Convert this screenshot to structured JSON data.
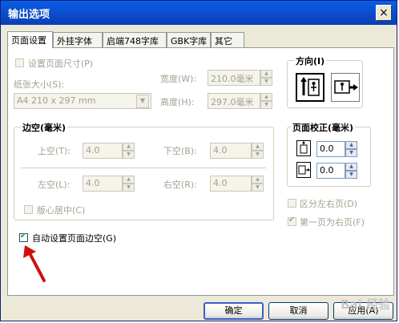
{
  "window": {
    "title": "输出选项",
    "close_label": "×"
  },
  "tabs": [
    {
      "label": "页面设置",
      "active": true
    },
    {
      "label": "外挂字体"
    },
    {
      "label": "启端748字库"
    },
    {
      "label": "GBK字库"
    },
    {
      "label": "其它"
    }
  ],
  "page_setup": {
    "custom_size_label": "设置页面尺寸(P)",
    "paper_size_label": "纸张大小(S):",
    "paper_size_value": "A4 210 x 297 mm",
    "width_label": "宽度(W):",
    "width_value": "210.0毫米",
    "height_label": "高度(H):",
    "height_value": "297.0毫米"
  },
  "orientation": {
    "title": "方向(I)"
  },
  "margins": {
    "title": "边空(毫米)",
    "top_label": "上空(T):",
    "top_value": "4.0",
    "bottom_label": "下空(B):",
    "bottom_value": "4.0",
    "left_label": "左空(L):",
    "left_value": "4.0",
    "right_label": "右空(R):",
    "right_value": "4.0",
    "center_label": "版心居中(C)"
  },
  "page_correction": {
    "title": "页面校正(毫米)",
    "x_value": "0.0",
    "y_value": "0.0"
  },
  "options": {
    "distinguish_pages_label": "区分左右页(D)",
    "first_page_right_label": "第一页为右页(F)",
    "auto_margins_label": "自动设置页面边空(G)"
  },
  "buttons": {
    "ok": "确定",
    "cancel": "取消",
    "apply": "应用(A)"
  },
  "watermark": "Bai 经验",
  "colors": {
    "titlebar": "#0b4fd0",
    "arrow": "#cc1010"
  }
}
